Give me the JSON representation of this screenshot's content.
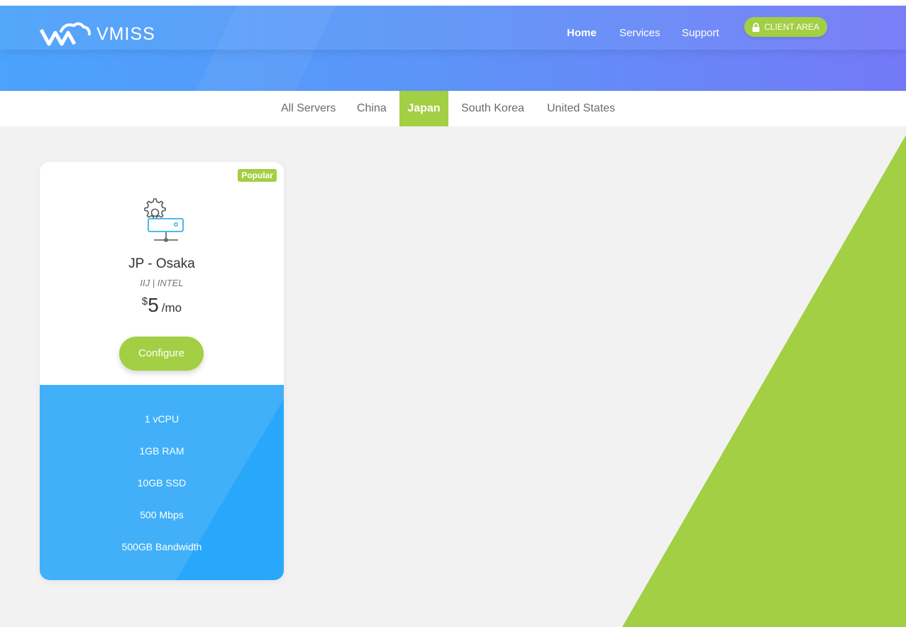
{
  "brand": {
    "name": "VMISS"
  },
  "nav": {
    "items": [
      "Home",
      "Services",
      "Support"
    ],
    "client_area": "CLIENT AREA"
  },
  "tabs": [
    "All Servers",
    "China",
    "Japan",
    "South Korea",
    "United States"
  ],
  "active_tab": "Japan",
  "plan": {
    "badge": "Popular",
    "name": "JP - Osaka",
    "sub": "IIJ | INTEL",
    "currency": "$",
    "price": "5",
    "period": "/mo",
    "cta": "Configure",
    "features": [
      "1 vCPU",
      "1GB RAM",
      "10GB SSD",
      "500 Mbps",
      "500GB Bandwidth"
    ]
  },
  "colors": {
    "accent_green": "#a2cf43",
    "header_start": "#4ba3fb",
    "header_end": "#7479f7",
    "features_blue": "#41b0f9"
  }
}
